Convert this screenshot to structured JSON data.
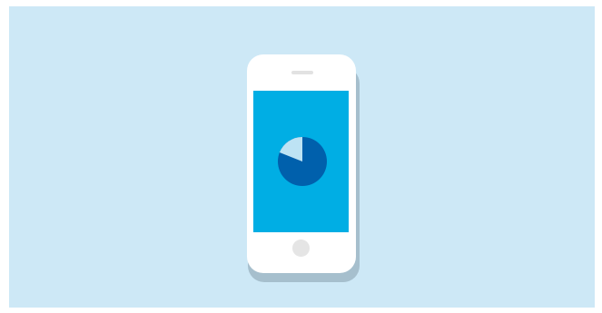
{
  "colors": {
    "background": "#cde8f6",
    "phone_shadow": "#a6bfcd",
    "phone_body": "#ffffff",
    "speaker": "#e2e2e2",
    "screen": "#00aee4",
    "pie_main": "#0060ac",
    "pie_slice": "#bde3f4",
    "home_button": "#e5e5e5"
  },
  "icons": {
    "device": "smartphone-icon",
    "chart": "pie-chart-icon"
  },
  "pie": {
    "highlighted_fraction": 0.19
  }
}
